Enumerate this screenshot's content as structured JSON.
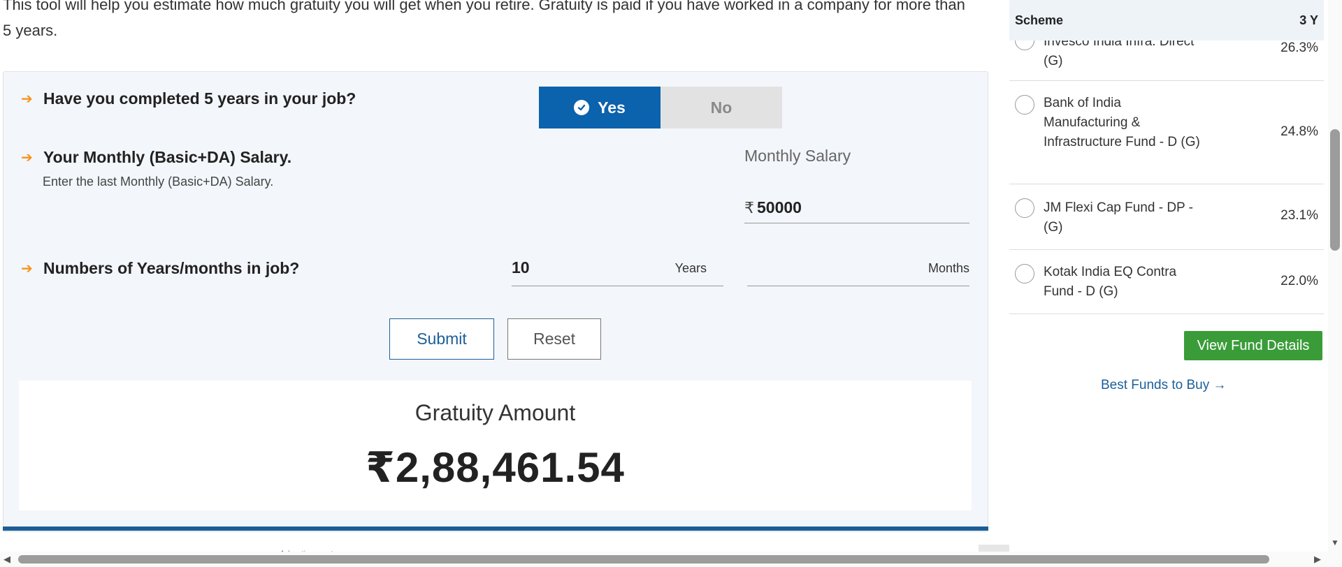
{
  "intro": "This tool will help you estimate how much gratuity you will get when you retire. Gratuity is paid if you have worked in a company for more than 5 years.",
  "form": {
    "q1": "Have you completed 5 years in your job?",
    "yes_label": "Yes",
    "no_label": "No",
    "q2": "Your Monthly (Basic+DA) Salary.",
    "q2_hint": "Enter the last Monthly (Basic+DA) Salary.",
    "salary_label": "Monthly Salary",
    "currency_symbol": "₹",
    "salary_value": "50000",
    "q3": "Numbers of Years/months in job?",
    "years_value": "10",
    "years_unit": "Years",
    "months_value": "",
    "months_unit": "Months",
    "submit_label": "Submit",
    "reset_label": "Reset"
  },
  "result": {
    "title": "Gratuity Amount",
    "value": "₹2,88,461.54"
  },
  "ad_label": "Advertisement",
  "funds": {
    "header_scheme": "Scheme",
    "header_return": "3 Y",
    "rows": [
      {
        "name": "Invesco India Infra. Direct (G)",
        "return": "26.3%"
      },
      {
        "name": "Bank of India Manufacturing & Infrastructure Fund - D (G)",
        "return": "24.8%"
      },
      {
        "name": "JM Flexi Cap Fund - DP - (G)",
        "return": "23.1%"
      },
      {
        "name": "Kotak India EQ Contra Fund - D (G)",
        "return": "22.0%"
      }
    ],
    "view_button": "View Fund Details",
    "best_link": "Best Funds to Buy →"
  },
  "colors": {
    "primary_blue": "#0b62ad",
    "accent_orange": "#f7931e",
    "green_button": "#3a9c39"
  }
}
